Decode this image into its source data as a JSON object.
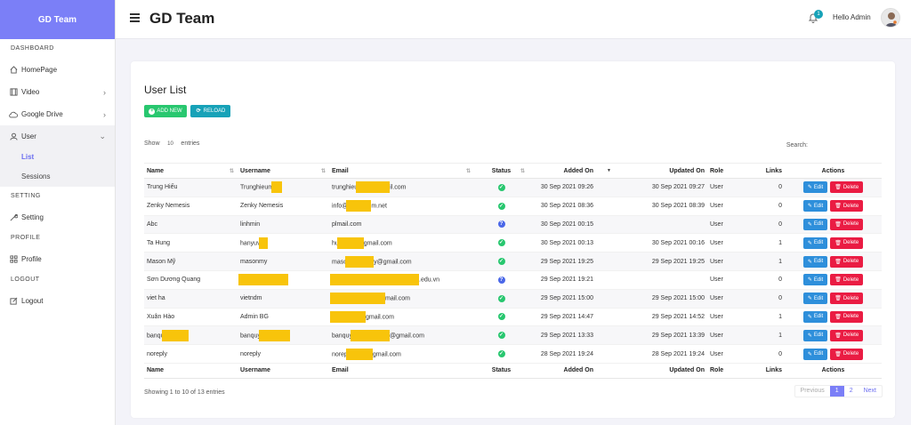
{
  "brand": "GD Team",
  "sidebar": {
    "sections": [
      "DASHBOARD",
      "SETTING",
      "PROFILE",
      "LOGOUT"
    ],
    "items": {
      "homepage": "HomePage",
      "video": "Video",
      "google_drive": "Google Drive",
      "user": "User",
      "list": "List",
      "sessions": "Sessions",
      "setting": "Setting",
      "profile": "Profile",
      "logout": "Logout"
    }
  },
  "topbar": {
    "title": "GD Team",
    "notification_count": "1",
    "greeting": "Hello Admin"
  },
  "card": {
    "title": "User List",
    "add_label": "ADD NEW",
    "reload_label": "RELOAD",
    "show_label": "Show",
    "show_value": "10",
    "entries_label": "entries",
    "search_label": "Search:",
    "info": "Showing 1 to 10 of 13 entries"
  },
  "table": {
    "headers": [
      "Name",
      "Username",
      "Email",
      "Status",
      "Added On",
      "Updated On",
      "Role",
      "Links",
      "Actions"
    ],
    "edit_label": "Edit",
    "delete_label": "Delete",
    "rows": [
      {
        "name": "Trung Hiếu",
        "username": "Trunghieum",
        "email": "trunghieu",
        "email_tail": "il.com",
        "status": "ok",
        "added": "30 Sep 2021 09:26",
        "updated": "30 Sep 2021 09:27",
        "role": "User",
        "links": "0"
      },
      {
        "name": "Zenky Nemesis",
        "username": "Zenky Nemesis",
        "email": "info@",
        "email_tail": "m.net",
        "status": "ok",
        "added": "30 Sep 2021 08:36",
        "updated": "30 Sep 2021 08:39",
        "role": "User",
        "links": "0"
      },
      {
        "name": "Abc",
        "username": "linhmin",
        "email": "pl",
        "email_tail": "mail.com",
        "status": "q",
        "added": "30 Sep 2021 00:15",
        "updated": "",
        "role": "User",
        "links": "0"
      },
      {
        "name": "Ta Hung",
        "username": "hanyuv",
        "email": "hu",
        "email_tail": "gmail.com",
        "status": "ok",
        "added": "30 Sep 2021 00:13",
        "updated": "30 Sep 2021 00:16",
        "role": "User",
        "links": "1"
      },
      {
        "name": "Mason Mỹ",
        "username": "masonmy",
        "email": "maso",
        "email_tail": "y@gmail.com",
        "status": "ok",
        "added": "29 Sep 2021 19:25",
        "updated": "29 Sep 2021 19:25",
        "role": "User",
        "links": "1"
      },
      {
        "name": "Sơn Dương Quang",
        "username": "",
        "email": "",
        "email_tail": ".edu.vn",
        "status": "q",
        "added": "29 Sep 2021 19:21",
        "updated": "",
        "role": "User",
        "links": "0"
      },
      {
        "name": "viet ha",
        "username": "vietndm",
        "email": "",
        "email_tail": "mail.com",
        "status": "ok",
        "added": "29 Sep 2021 15:00",
        "updated": "29 Sep 2021 15:00",
        "role": "User",
        "links": "0"
      },
      {
        "name": "Xuân Hào",
        "username": "Admin BG",
        "email": "",
        "email_tail": "gmail.com",
        "status": "ok",
        "added": "29 Sep 2021 14:47",
        "updated": "29 Sep 2021 14:52",
        "role": "User",
        "links": "1"
      },
      {
        "name": "banqu",
        "username": "banquy",
        "email": "banquy",
        "email_tail": "@gmail.com",
        "status": "ok",
        "added": "29 Sep 2021 13:33",
        "updated": "29 Sep 2021 13:39",
        "role": "User",
        "links": "1"
      },
      {
        "name": "noreply",
        "username": "noreply",
        "email": "norep",
        "email_tail": "gmail.com",
        "status": "ok",
        "added": "28 Sep 2021 19:24",
        "updated": "28 Sep 2021 19:24",
        "role": "User",
        "links": "0"
      }
    ]
  },
  "pager": {
    "prev": "Previous",
    "pages": [
      "1",
      "2"
    ],
    "next": "Next"
  }
}
